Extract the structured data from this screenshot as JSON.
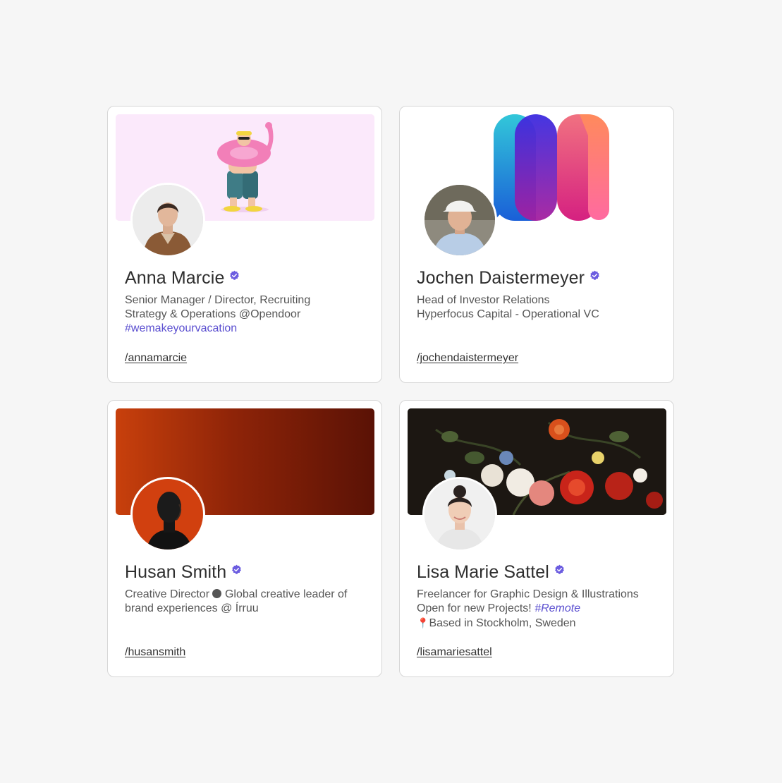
{
  "cards": [
    {
      "name": "Anna Marcie",
      "bio": [
        "Senior Manager / Director, Recruiting",
        "Strategy & Operations @Opendoor"
      ],
      "hashtag": "#wemakeyourvacation",
      "handle": "/annamarcie",
      "banner_color": "#fbe9fb"
    },
    {
      "name": "Jochen Daistermeyer",
      "bio": [
        "Head of Investor Relations",
        "Hyperfocus Capital - Operational VC"
      ],
      "handle": "/jochendaistermeyer",
      "banner_color": "#ffffff"
    },
    {
      "name": "Husan Smith",
      "bio_prefix": "Creative Director",
      "bio_suffix": "Global creative leader of",
      "bio_line2": "brand experiences @ Írruu",
      "handle": "/husansmith",
      "banner_gradient": [
        "#c8400c",
        "#5a1205"
      ]
    },
    {
      "name": "Lisa Marie Sattel",
      "bio_line1": "Freelancer for Graphic Design & Illustrations",
      "bio_line2_prefix": "Open for new Projects!",
      "hashtag": "#Remote",
      "location": "Based in Stockholm, Sweden",
      "handle": "/lisamariesattel",
      "banner_color": "#1c1712"
    }
  ],
  "icons": {
    "verified": "verified-badge-icon",
    "location": "location-pin-icon",
    "separator": "dot-separator-icon"
  },
  "colors": {
    "background": "#f6f6f6",
    "accent": "#5b4fd0",
    "verified": "#6b5ce0"
  }
}
